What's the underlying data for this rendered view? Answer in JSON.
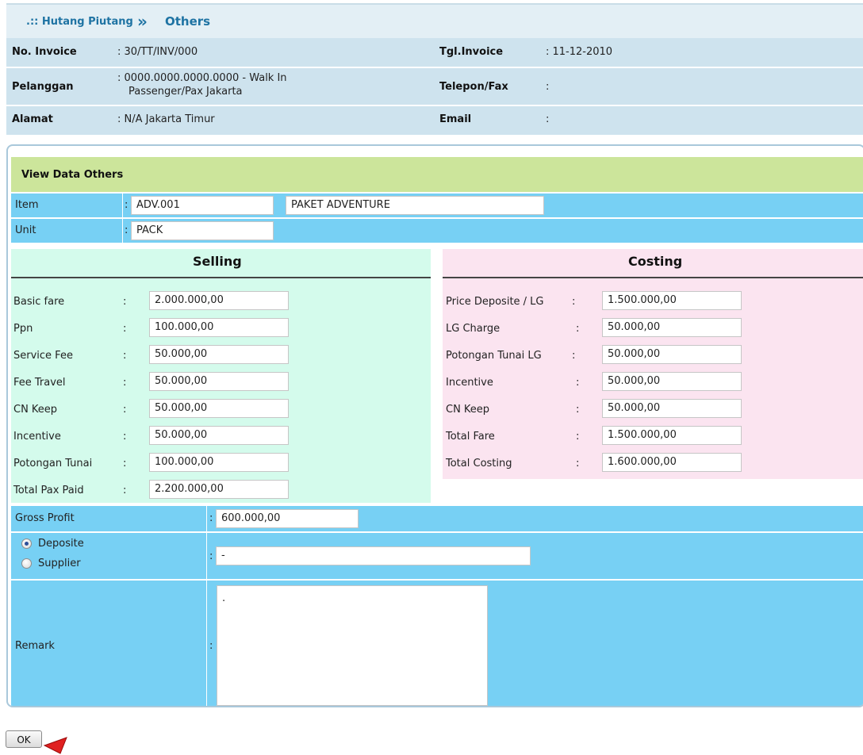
{
  "breadcrumb": {
    "prefix": ".:: Hutang Piutang",
    "separator": "»",
    "current": "Others"
  },
  "invoice": {
    "no_invoice_label": "No. Invoice",
    "no_invoice_value": ": 30/TT/INV/000",
    "tgl_invoice_label": "Tgl.Invoice",
    "tgl_invoice_value": ": 11-12-2010",
    "pelanggan_label": "Pelanggan",
    "pelanggan_value_line1": ": 0000.0000.0000.0000 - Walk In",
    "pelanggan_value_line2": "Passenger/Pax Jakarta",
    "telepon_label": "Telepon/Fax",
    "telepon_value": ":",
    "alamat_label": "Alamat",
    "alamat_value": ": N/A Jakarta Timur",
    "email_label": "Email",
    "email_value": ":"
  },
  "section_title": "View Data Others",
  "item": {
    "label": "Item",
    "colon": ":",
    "code": "ADV.001",
    "name": "PAKET ADVENTURE"
  },
  "unit": {
    "label": "Unit",
    "colon": ":",
    "value": "PACK"
  },
  "selling": {
    "title": "Selling",
    "rows": [
      {
        "label": "Basic fare",
        "colon": ":",
        "value": "2.000.000,00"
      },
      {
        "label": "Ppn",
        "colon": ":",
        "value": "100.000,00"
      },
      {
        "label": "Service Fee",
        "colon": ":",
        "value": "50.000,00"
      },
      {
        "label": "Fee Travel",
        "colon": ":",
        "value": "50.000,00"
      },
      {
        "label": "CN Keep",
        "colon": ":",
        "value": "50.000,00"
      },
      {
        "label": "Incentive",
        "colon": ":",
        "value": "50.000,00"
      },
      {
        "label": "Potongan Tunai",
        "colon": ":",
        "value": "100.000,00"
      },
      {
        "label": "Total Pax Paid",
        "colon": ":",
        "value": "2.200.000,00"
      }
    ]
  },
  "costing": {
    "title": "Costing",
    "rows": [
      {
        "label": "Price Deposite / LG",
        "colon": ":",
        "value": "1.500.000,00"
      },
      {
        "label": "LG Charge",
        "colon": ":",
        "value": "50.000,00"
      },
      {
        "label": "Potongan Tunai LG",
        "colon": ":",
        "value": "50.000,00"
      },
      {
        "label": "Incentive",
        "colon": ":",
        "value": "50.000,00"
      },
      {
        "label": "CN Keep",
        "colon": ":",
        "value": "50.000,00"
      },
      {
        "label": "Total Fare",
        "colon": ":",
        "value": "1.500.000,00"
      },
      {
        "label": "Total Costing",
        "colon": ":",
        "value": "1.600.000,00"
      }
    ]
  },
  "gross_profit": {
    "label": "Gross Profit",
    "colon": ":",
    "value": "600.000,00"
  },
  "payment_source": {
    "options": [
      {
        "label": "Deposite",
        "checked": true
      },
      {
        "label": "Supplier",
        "checked": false
      }
    ],
    "colon": ":",
    "value": "-"
  },
  "remark": {
    "label": "Remark",
    "colon": ":",
    "value": "."
  },
  "ok_button": {
    "label": "OK"
  },
  "colors": {
    "header_bg": "#cee3ee",
    "section_green": "#cce59b",
    "row_blue": "#77d0f4",
    "selling_bg": "#d4fbec",
    "costing_bg": "#fbe4f0",
    "link_blue": "#1e73a3"
  }
}
